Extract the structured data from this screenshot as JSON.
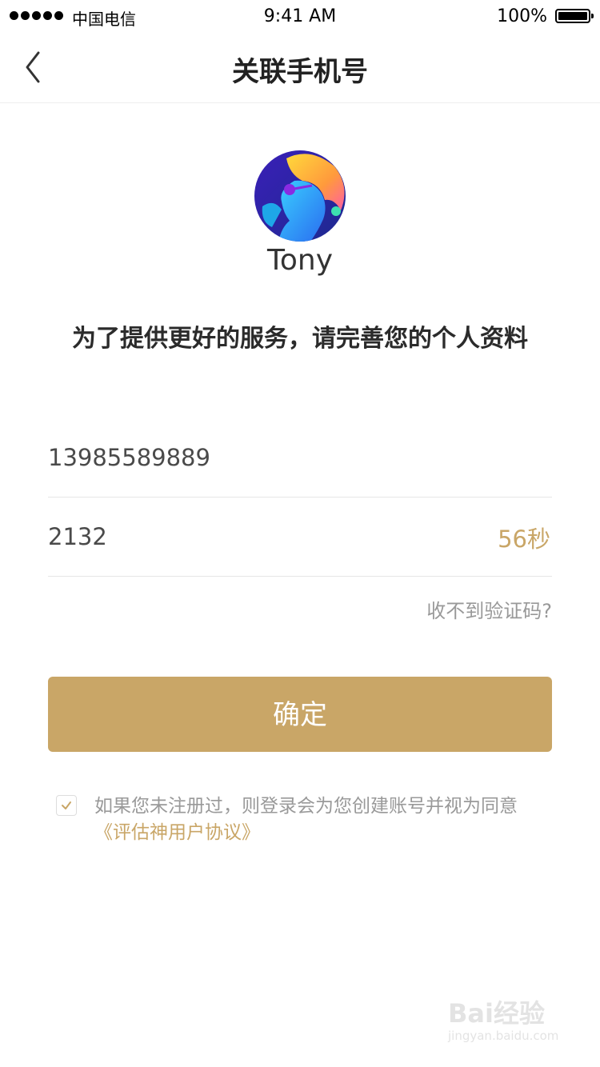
{
  "status_bar": {
    "carrier": "中国电信",
    "time": "9:41 AM",
    "battery_percent": "100%"
  },
  "nav": {
    "title": "关联手机号",
    "back_icon": "chevron-left-icon"
  },
  "profile": {
    "name": "Tony",
    "subtitle": "为了提供更好的服务，请完善您的个人资料"
  },
  "form": {
    "phone_value": "13985589889",
    "code_value": "2132",
    "countdown": "56秒",
    "resend_link": "收不到验证码?"
  },
  "confirm_button": "确定",
  "agreement": {
    "checked": true,
    "text": "如果您未注册过，则登录会为您创建账号并视为同意",
    "link": "《评估神用户协议》"
  },
  "watermark": {
    "logo": "Bai经验",
    "url": "jingyan.baidu.com"
  },
  "colors": {
    "accent": "#c9a667",
    "text_dark": "#2b2b2b",
    "text_muted": "#999999",
    "divider": "#e6e6e6"
  }
}
